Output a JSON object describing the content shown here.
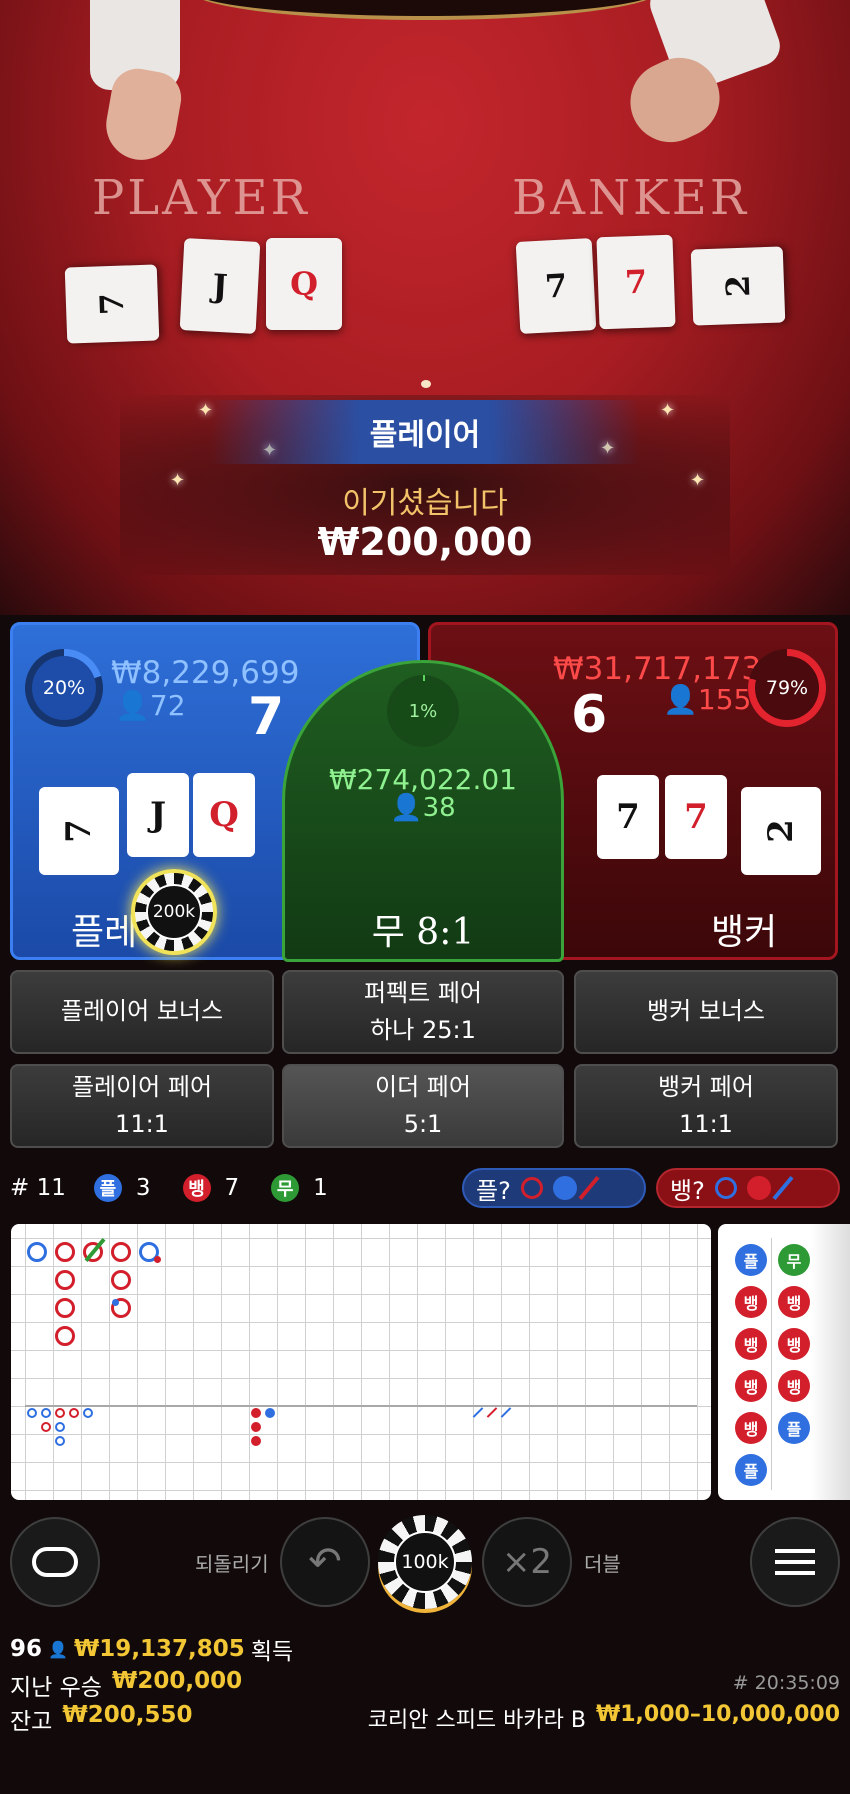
{
  "table": {
    "player_label": "PLAYER",
    "banker_label": "BANKER",
    "player_cards": [
      "7",
      "J",
      "Q"
    ],
    "banker_cards": [
      "7",
      "7",
      "2"
    ]
  },
  "result": {
    "winner": "플레이어",
    "message": "이기셨습니다",
    "amount": "₩200,000"
  },
  "player": {
    "pct": "20%",
    "total": "₩8,229,699",
    "count": "72",
    "score": "7",
    "cards": [
      "7",
      "J",
      "Q"
    ],
    "label": "플레이어",
    "chip": "200k"
  },
  "tie": {
    "pct": "1%",
    "total": "₩274,022.01",
    "count": "38",
    "label": "무 8:1"
  },
  "banker": {
    "pct": "79%",
    "total": "₩31,717,173",
    "count": "155",
    "score": "6",
    "cards": [
      "7",
      "7",
      "2"
    ],
    "label": "뱅커"
  },
  "side_bets": [
    {
      "line1": "플레이어 보너스",
      "line2": ""
    },
    {
      "line1": "퍼펙트 페어",
      "line2": "하나 25:1"
    },
    {
      "line1": "뱅커 보너스",
      "line2": ""
    },
    {
      "line1": "플레이어 페어",
      "line2": "11:1"
    },
    {
      "line1": "이더 페어",
      "line2": "5:1"
    },
    {
      "line1": "뱅커 페어",
      "line2": "11:1"
    }
  ],
  "stats": {
    "round": "# 11",
    "p_label": "플",
    "p_count": "3",
    "b_label": "뱅",
    "b_count": "7",
    "t_label": "무",
    "t_count": "1",
    "p_predict": "플?",
    "b_predict": "뱅?"
  },
  "bead_road": [
    "플",
    "무",
    "뱅",
    "뱅",
    "뱅",
    "뱅",
    "뱅",
    "뱅",
    "뱅",
    "플",
    "플"
  ],
  "controls": {
    "undo_label": "되돌리기",
    "chip": "100k",
    "double_symbol": "×2",
    "double_label": "더블"
  },
  "footer": {
    "players": "96",
    "won": "₩19,137,805",
    "won_label": "획득",
    "last_win_label": "지난 우승",
    "last_win": "₩200,000",
    "time": "# 20:35:09",
    "balance_label": "잔고",
    "balance": "₩200,550",
    "table_name": "코리안 스피드 바카라 B",
    "limits": "₩1,000–10,000,000"
  },
  "colors": {
    "player": "#2f6fe0",
    "banker": "#d21f2b",
    "tie": "#2e9a35",
    "gold": "#f2c634"
  }
}
